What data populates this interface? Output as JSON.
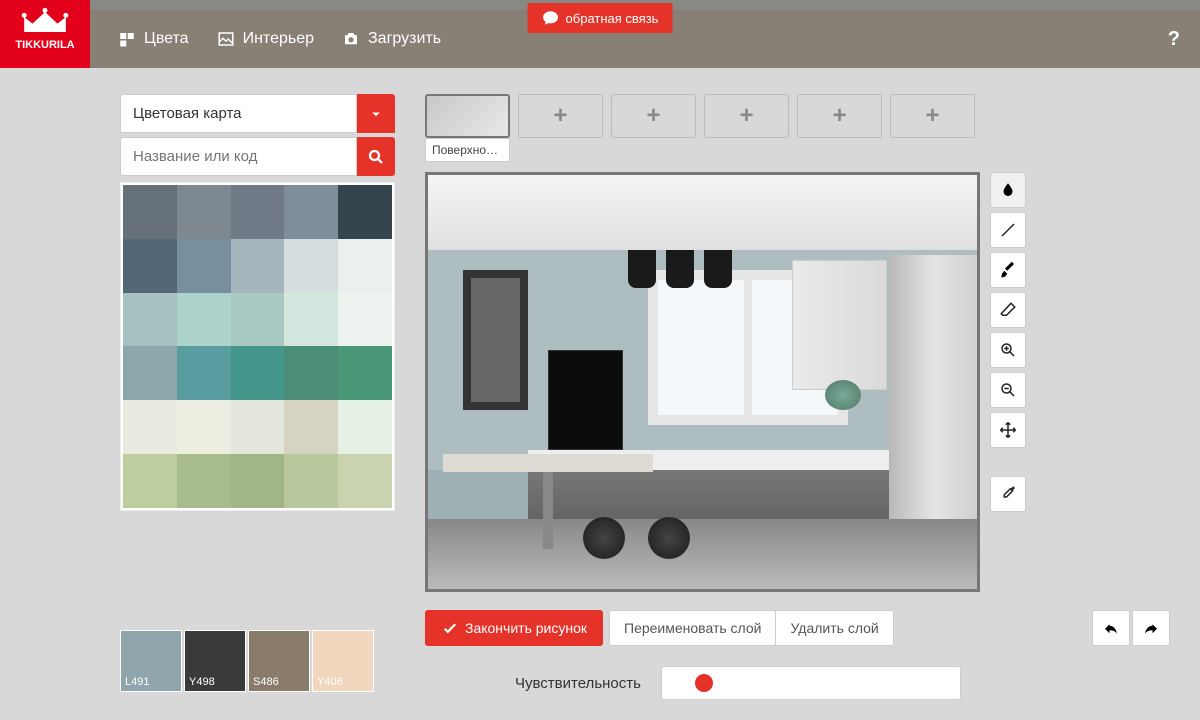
{
  "feedback_label": "обратная связь",
  "brand": "TIKKURILA",
  "nav": {
    "colors": "Цвета",
    "interior": "Интерьер",
    "upload": "Загрузить",
    "help": "?"
  },
  "color_panel": {
    "map_label": "Цветовая карта",
    "search_placeholder": "Название или код",
    "swatches": [
      "#667079",
      "#7d8890",
      "#707986",
      "#7f8d99",
      "#36444d",
      "#536876",
      "#788fa0",
      "#a4b5bc",
      "#d4dee0",
      "#eaf0ee",
      "#a6c2c0",
      "#acd2c9",
      "#a9c8c1",
      "#d4e7df",
      "#edf3ee",
      "#8ba7ab",
      "#5a9da0",
      "#45968a",
      "#4c8d78",
      "#4a9778",
      "#e9ebe1",
      "#eceee2",
      "#e3e6da",
      "#d6d4c0",
      "#e6f1e5",
      "#becd9d",
      "#a7bc8a",
      "#a1b686",
      "#b8c89c",
      "#c9d3b0"
    ]
  },
  "selected_colors": [
    {
      "code": "L491",
      "hex": "#8fa5ab"
    },
    {
      "code": "Y498",
      "hex": "#3a3a3a"
    },
    {
      "code": "S486",
      "hex": "#8a7c6b"
    },
    {
      "code": "Y406",
      "hex": "#f2d7be"
    }
  ],
  "surface_tab_label": "Поверхно…",
  "tools": {
    "fill": "fill-icon",
    "line": "line-icon",
    "brush": "brush-icon",
    "eraser": "eraser-icon",
    "zoom_in": "zoom-in-icon",
    "zoom_out": "zoom-out-icon",
    "move": "move-icon",
    "eyedropper": "eyedropper-icon"
  },
  "actions": {
    "finish": "Закончить рисунок",
    "rename": "Переименовать слой",
    "delete": "Удалить слой"
  },
  "sensitivity_label": "Чувствительность",
  "sensitivity_value": 15
}
